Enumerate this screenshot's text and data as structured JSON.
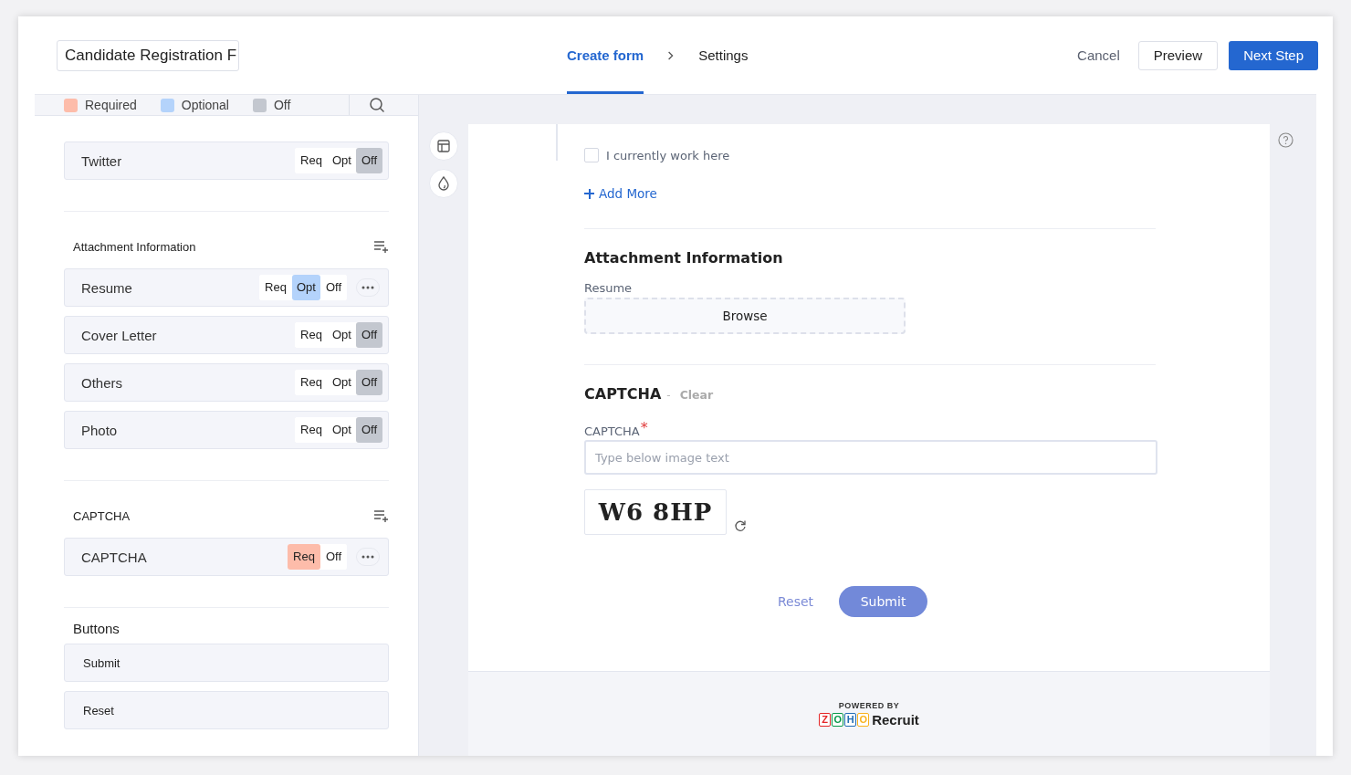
{
  "form_name": "Candidate Registration F",
  "steps": [
    {
      "label": "Create form",
      "selected": true
    },
    {
      "label": "Settings",
      "selected": false
    }
  ],
  "actions": {
    "cancel": "Cancel",
    "preview": "Preview",
    "next": "Next Step"
  },
  "legend": [
    {
      "label": "Required",
      "color": "#fdbcaa"
    },
    {
      "label": "Optional",
      "color": "#b4d3fb"
    },
    {
      "label": "Off",
      "color": "#c3c7cf"
    }
  ],
  "sidebar_sections": [
    {
      "fields": [
        {
          "label": "Twitter",
          "has_more": false,
          "options": [
            {
              "label": "Req",
              "kind": "req",
              "selected": false
            },
            {
              "label": "Opt",
              "kind": "opt",
              "selected": false
            },
            {
              "label": "Off",
              "kind": "off",
              "selected": true
            }
          ]
        }
      ]
    },
    {
      "title": "Attachment Information",
      "fields": [
        {
          "label": "Resume",
          "has_more": true,
          "options": [
            {
              "label": "Req",
              "kind": "req",
              "selected": false
            },
            {
              "label": "Opt",
              "kind": "opt",
              "selected": true
            },
            {
              "label": "Off",
              "kind": "off",
              "selected": false
            }
          ]
        },
        {
          "label": "Cover Letter",
          "has_more": false,
          "options": [
            {
              "label": "Req",
              "kind": "req",
              "selected": false
            },
            {
              "label": "Opt",
              "kind": "opt",
              "selected": false
            },
            {
              "label": "Off",
              "kind": "off",
              "selected": true
            }
          ]
        },
        {
          "label": "Others",
          "has_more": false,
          "options": [
            {
              "label": "Req",
              "kind": "req",
              "selected": false
            },
            {
              "label": "Opt",
              "kind": "opt",
              "selected": false
            },
            {
              "label": "Off",
              "kind": "off",
              "selected": true
            }
          ]
        },
        {
          "label": "Photo",
          "has_more": false,
          "options": [
            {
              "label": "Req",
              "kind": "req",
              "selected": false
            },
            {
              "label": "Opt",
              "kind": "opt",
              "selected": false
            },
            {
              "label": "Off",
              "kind": "off",
              "selected": true
            }
          ]
        }
      ]
    },
    {
      "title": "CAPTCHA",
      "fields": [
        {
          "label": "CAPTCHA",
          "has_more": true,
          "options": [
            {
              "label": "Req",
              "kind": "req",
              "selected": true
            },
            {
              "label": "Off",
              "kind": "off",
              "selected": false
            }
          ]
        }
      ]
    }
  ],
  "buttons_section": {
    "title": "Buttons",
    "items": [
      "Submit",
      "Reset"
    ]
  },
  "form": {
    "checkbox": {
      "label": "I currently work here",
      "checked": false
    },
    "add_more": "Add More",
    "attachment_title": "Attachment Information",
    "resume_label": "Resume",
    "browse": "Browse",
    "captcha_title": "CAPTCHA",
    "captcha_sep": "-",
    "clear": "Clear",
    "captcha_label": "CAPTCHA",
    "required_mark": "*",
    "captcha_placeholder": "Type below image text",
    "captcha_text": "W6 8HP",
    "reset": "Reset",
    "submit": "Submit"
  },
  "footer": {
    "powered_by": "POWERED BY",
    "logo_letters": [
      {
        "letter": "Z",
        "color": "#e42527"
      },
      {
        "letter": "O",
        "color": "#089949"
      },
      {
        "letter": "H",
        "color": "#226db4"
      },
      {
        "letter": "O",
        "color": "#f9b21d"
      }
    ],
    "product": "Recruit"
  }
}
